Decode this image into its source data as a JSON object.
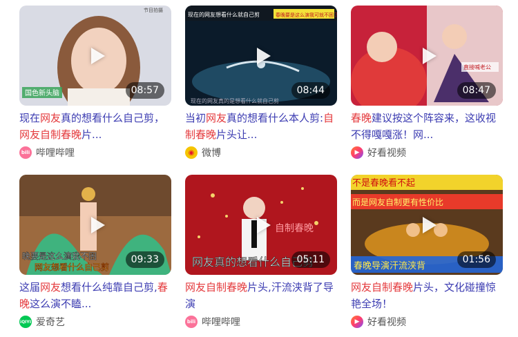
{
  "cards": [
    {
      "duration": "08:57",
      "title_parts": [
        {
          "t": "现在",
          "hl": false
        },
        {
          "t": "网友",
          "hl": true
        },
        {
          "t": "真的想看什么自己剪，",
          "hl": false
        },
        {
          "t": "网友",
          "hl": true
        },
        {
          "t": "自制",
          "hl": true
        },
        {
          "t": "春晚",
          "hl": true
        },
        {
          "t": "片...",
          "hl": false
        }
      ],
      "source": "哔哩哔哩",
      "source_icon": "bilibili-icon",
      "thumb_overlay_text": [
        "国色新头脑",
        "节目拍摄"
      ]
    },
    {
      "duration": "08:44",
      "title_parts": [
        {
          "t": "当初",
          "hl": false
        },
        {
          "t": "网友",
          "hl": true
        },
        {
          "t": "真的想看什么本人剪:",
          "hl": false
        },
        {
          "t": "自制",
          "hl": true
        },
        {
          "t": "春晚",
          "hl": true
        },
        {
          "t": "片头让...",
          "hl": false
        }
      ],
      "source": "微博",
      "source_icon": "weibo-icon",
      "thumb_overlay_text": [
        "现在的网友想看什么就自己剪",
        "春晚要是这么演我可就不困了",
        "现在的网友真的是想看什么就自己剪"
      ]
    },
    {
      "duration": "08:47",
      "title_parts": [
        {
          "t": "春晚",
          "hl": true
        },
        {
          "t": "建议按这个阵容来，这收视不得嘎嘎涨！网...",
          "hl": false
        }
      ],
      "source": "好看视频",
      "source_icon": "haokan-icon",
      "thumb_overlay_text": [
        "直接喊老公"
      ]
    },
    {
      "duration": "09:33",
      "title_parts": [
        {
          "t": "这届",
          "hl": false
        },
        {
          "t": "网友",
          "hl": true
        },
        {
          "t": "想看什么纯靠自己剪,",
          "hl": false
        },
        {
          "t": "春晚",
          "hl": true
        },
        {
          "t": "这么演不瞌...",
          "hl": false
        }
      ],
      "source": "爱奇艺",
      "source_icon": "iqiyi-icon",
      "thumb_overlay_text": [
        "晚要是这么演我不困",
        "网友想看什么自己剪"
      ]
    },
    {
      "duration": "05:11",
      "title_parts": [
        {
          "t": "网友",
          "hl": true
        },
        {
          "t": "自制",
          "hl": true
        },
        {
          "t": "春晚",
          "hl": true
        },
        {
          "t": "片头,汗流浃背了导演",
          "hl": false
        }
      ],
      "source": "哔哩哔哩",
      "source_icon": "bilibili-icon",
      "thumb_overlay_text": [
        "自制春晚",
        "网友真的想看什么自己剪"
      ]
    },
    {
      "duration": "01:56",
      "title_parts": [
        {
          "t": "网友",
          "hl": true
        },
        {
          "t": "自制",
          "hl": true
        },
        {
          "t": "春晚",
          "hl": true
        },
        {
          "t": "片头，文化碰撞惊艳全场！",
          "hl": false
        }
      ],
      "source": "好看视频",
      "source_icon": "haokan-icon",
      "thumb_overlay_text": [
        "不是春晚看不起",
        "而是网友自制更有性价比",
        "春晚导演汗流浃背"
      ]
    }
  ],
  "colors": {
    "link": "#3b3bb1",
    "highlight": "#e4393c",
    "source_text": "#555555",
    "bilibili": "#fb7299",
    "weibo": "#e6162d",
    "haokan": "#ff3d6e",
    "iqiyi": "#00c853"
  }
}
